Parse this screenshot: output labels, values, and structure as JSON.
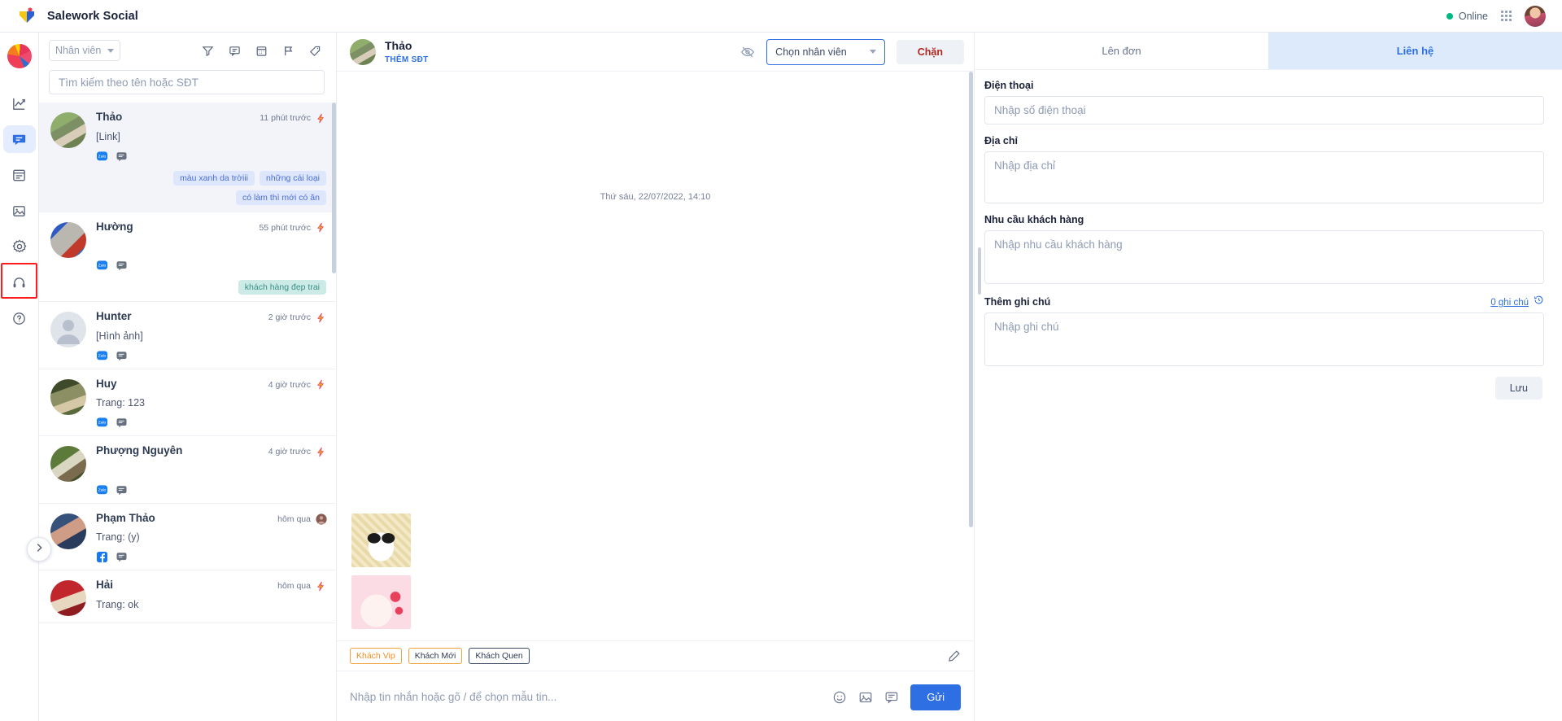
{
  "topbar": {
    "brand": "Salework Social",
    "status_label": "Online",
    "status_color": "#00b884",
    "apps_icon": "grid-apps-icon",
    "avatar_icon": "user-avatar"
  },
  "rail": {
    "items": [
      {
        "icon": "analytics-chart-icon",
        "active": false
      },
      {
        "icon": "chat-bubble-icon",
        "active": true
      },
      {
        "icon": "list-panel-icon",
        "active": false
      },
      {
        "icon": "image-gallery-icon",
        "active": false
      },
      {
        "icon": "gear-settings-icon",
        "active": false,
        "highlighted": true
      },
      {
        "icon": "headset-support-icon",
        "active": false
      },
      {
        "icon": "question-help-icon",
        "active": false
      }
    ],
    "expand_icon": "chevron-right-icon",
    "highlight_color": "#ff1c1c"
  },
  "conversations": {
    "employee_filter": "Nhân viên",
    "search_placeholder": "Tìm kiếm theo tên hoặc SĐT",
    "toolbar_icons": [
      "filter-icon",
      "comment-icon",
      "calendar-icon",
      "flag-icon",
      "tag-icon"
    ],
    "items": [
      {
        "name": "Thảo",
        "time": "11 phút trước",
        "snippet": "[Link]",
        "channels": [
          "zalo-icon",
          "chat-icon"
        ],
        "tags": [
          "màu xanh da trờiii",
          "những cái loại",
          "có làm thì mới có ăn"
        ],
        "tag_style": "blue",
        "selected": true,
        "avatar": "av1"
      },
      {
        "name": "Hường",
        "time": "55 phút trước",
        "snippet": "",
        "channels": [
          "zalo-icon",
          "chat-icon"
        ],
        "tags": [
          "khách hàng đẹp trai"
        ],
        "tag_style": "teal",
        "selected": false,
        "avatar": "av2"
      },
      {
        "name": "Hunter",
        "time": "2 giờ trước",
        "snippet": "[Hình ảnh]",
        "channels": [
          "zalo-icon",
          "chat-icon"
        ],
        "tags": [],
        "tag_style": "blue",
        "selected": false,
        "avatar": "av3"
      },
      {
        "name": "Huy",
        "time": "4 giờ trước",
        "snippet": "Trang: 123",
        "channels": [
          "zalo-icon",
          "chat-icon"
        ],
        "tags": [],
        "tag_style": "blue",
        "selected": false,
        "avatar": "av4"
      },
      {
        "name": "Phượng Nguyên",
        "time": "4 giờ trước",
        "snippet": "",
        "channels": [
          "zalo-icon",
          "chat-icon"
        ],
        "tags": [],
        "tag_style": "blue",
        "selected": false,
        "avatar": "av5"
      },
      {
        "name": "Phạm Thảo",
        "time": "hôm qua",
        "snippet": "Trang: (y)",
        "channels": [
          "facebook-icon",
          "chat-icon"
        ],
        "tags": [],
        "tag_style": "blue",
        "selected": false,
        "avatar": "av6"
      },
      {
        "name": "Hải",
        "time": "hôm qua",
        "snippet": "Trang: ok",
        "channels": [],
        "tags": [],
        "tag_style": "blue",
        "selected": false,
        "avatar": "av7"
      }
    ]
  },
  "chat": {
    "contact_name": "Thảo",
    "add_phone_label": "THÊM SĐT",
    "eye_icon": "eye-off-icon",
    "staff_select": "Chọn nhân viên",
    "block_label": "Chặn",
    "date_divider": "Thứ sáu, 22/07/2022, 14:10",
    "stickers": [
      "sticker-cat-praying",
      "sticker-cat-hearts"
    ],
    "quick_tags": [
      "Khách Vip",
      "Khách Mới",
      "Khách Quen"
    ],
    "edit_icon": "pencil-edit-icon",
    "composer_placeholder": "Nhập tin nhắn hoặc gõ / để chọn mẫu tin...",
    "composer_icons": [
      "emoji-icon",
      "image-attach-icon",
      "message-template-icon"
    ],
    "send_label": "Gửi"
  },
  "right_panel": {
    "tabs": [
      {
        "label": "Lên đơn",
        "active": false
      },
      {
        "label": "Liên hệ",
        "active": true
      }
    ],
    "fields": [
      {
        "label": "Điện thoại",
        "placeholder": "Nhập số điện thoại",
        "type": "input"
      },
      {
        "label": "Địa chỉ",
        "placeholder": "Nhập địa chỉ",
        "type": "textarea"
      },
      {
        "label": "Nhu cầu khách hàng",
        "placeholder": "Nhập nhu cầu khách hàng",
        "type": "textarea"
      }
    ],
    "note_label": "Thêm ghi chú",
    "note_count_link": "0 ghi chú",
    "note_history_icon": "history-clock-icon",
    "note_placeholder": "Nhập ghi chú",
    "save_label": "Lưu"
  }
}
